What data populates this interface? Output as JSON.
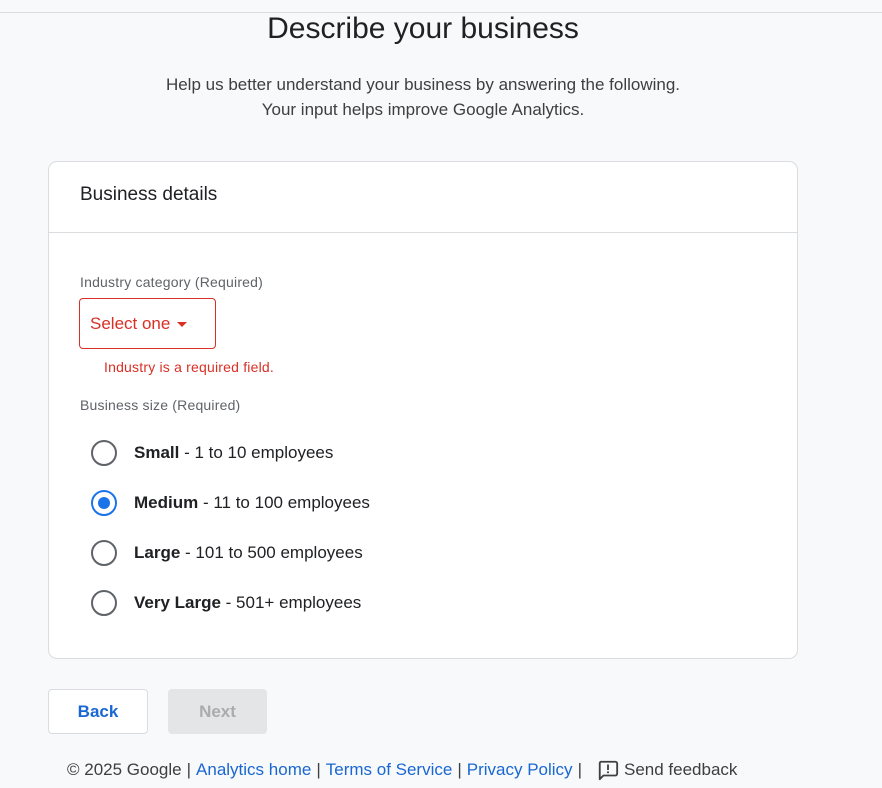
{
  "page": {
    "title": "Describe your business",
    "subtitle_line1": "Help us better understand your business by answering the following.",
    "subtitle_line2": "Your input helps improve Google Analytics."
  },
  "card": {
    "header": "Business details",
    "industry": {
      "label": "Industry category (Required)",
      "selected": "Select one",
      "error": "Industry is a required field."
    },
    "size": {
      "label": "Business size (Required)",
      "options": [
        {
          "name": "Small",
          "desc": " - 1 to 10 employees",
          "checked": false
        },
        {
          "name": "Medium",
          "desc": " - 11 to 100 employees",
          "checked": true
        },
        {
          "name": "Large",
          "desc": " - 101 to 500 employees",
          "checked": false
        },
        {
          "name": "Very Large",
          "desc": " - 501+ employees",
          "checked": false
        }
      ]
    }
  },
  "buttons": {
    "back": "Back",
    "next": "Next"
  },
  "footer": {
    "copyright": "© 2025 Google",
    "links": [
      "Analytics home",
      "Terms of Service",
      "Privacy Policy"
    ],
    "feedback": "Send feedback",
    "separator": "|"
  },
  "colors": {
    "error": "#d93025",
    "primary": "#1a73e8",
    "link": "#1967d2"
  },
  "icons": {
    "select_caret": "caret-down-icon",
    "feedback": "feedback-icon"
  }
}
